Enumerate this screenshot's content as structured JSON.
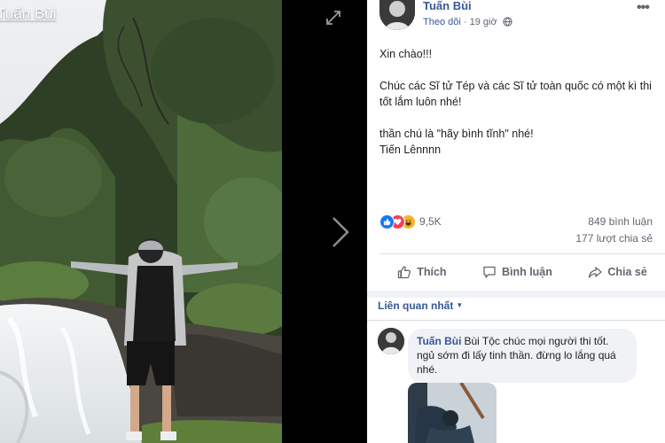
{
  "photo": {
    "owner_name": "Tuấn Bùi"
  },
  "viewer": {
    "expand_icon": "expand-icon",
    "next_icon": "chevron-right-icon"
  },
  "post": {
    "author": "Tuấn Bùi",
    "follow_label": "Theo dõi",
    "separator": " · ",
    "time": "19 giờ",
    "privacy_icon": "globe-icon",
    "more_icon": "more-dots-icon",
    "paragraphs": [
      "Xin chào!!!",
      "Chúc các Sĩ tử Tép và các Sĩ tử toàn quốc có một kì thi tốt lắm luôn nhé!",
      "thần chú là \"hãy bình tĩnh\" nhé!",
      "Tiến Lênnnn"
    ],
    "reaction_count": "9,5K",
    "comment_count": "849 bình luận",
    "share_count": "177 lượt chia sẻ",
    "actions": {
      "like": "Thích",
      "comment": "Bình luận",
      "share": "Chia sẻ"
    }
  },
  "comments": {
    "sort_label": "Liên quan nhất",
    "items": [
      {
        "author": "Tuấn Bùi",
        "text": "Bùi Tộc chúc mọi người thi tốt. ngủ sớm đi lấy tinh thần. đừng lo lắng quá nhé."
      }
    ]
  },
  "colors": {
    "link_blue": "#385898",
    "like_blue": "#1877f2",
    "love_red": "#f33e58",
    "haha_yellow": "#f7b125",
    "muted_text": "#606770",
    "bubble_bg": "#f0f2f5"
  }
}
